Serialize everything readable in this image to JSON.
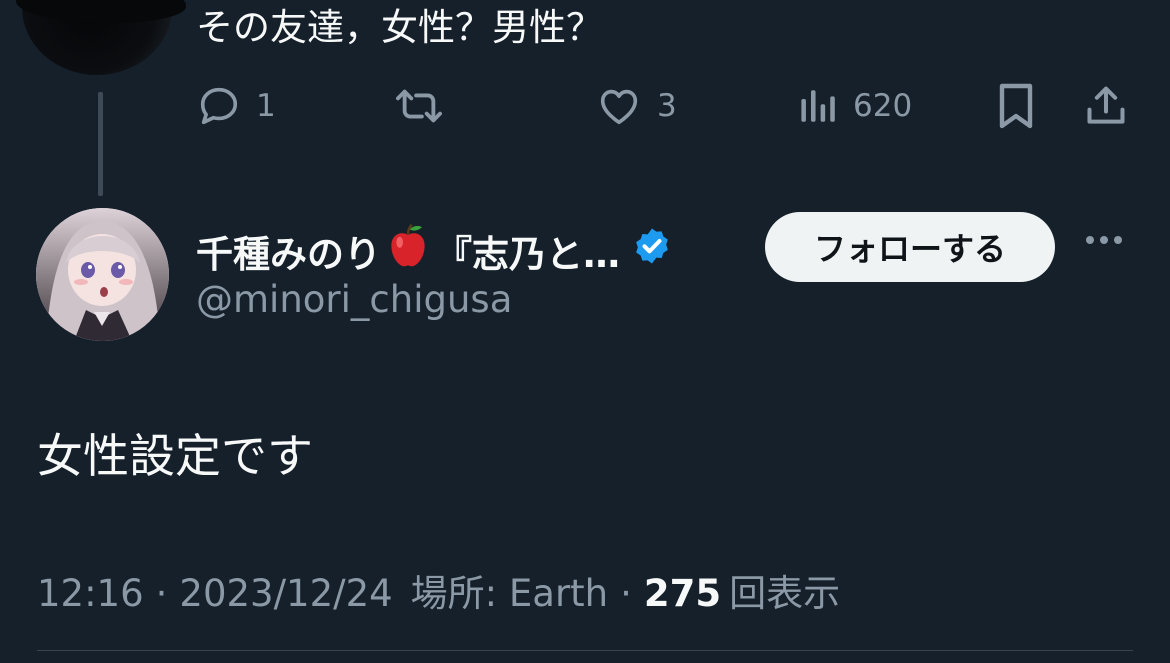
{
  "parent_tweet": {
    "text": "その友達，女性？男性？",
    "actions": {
      "reply_count": "1",
      "retweet_count": "",
      "like_count": "3",
      "views_count": "620"
    }
  },
  "reply": {
    "author": {
      "display_name": "千種みのり",
      "name_suffix": "『志乃と…",
      "handle": "@minori_chigusa",
      "verified": true
    },
    "follow_label": "フォローする",
    "text": "女性設定です",
    "meta": {
      "time": "12:16",
      "date": "2023/12/24",
      "location_label": "場所: Earth",
      "views_count": "275",
      "views_label": "回表示"
    }
  },
  "colors": {
    "background": "#15202b",
    "text_primary": "#f7f9f9",
    "text_secondary": "#8b98a5",
    "verified_blue": "#1d9bf0",
    "follow_button_bg": "#eff3f4"
  }
}
